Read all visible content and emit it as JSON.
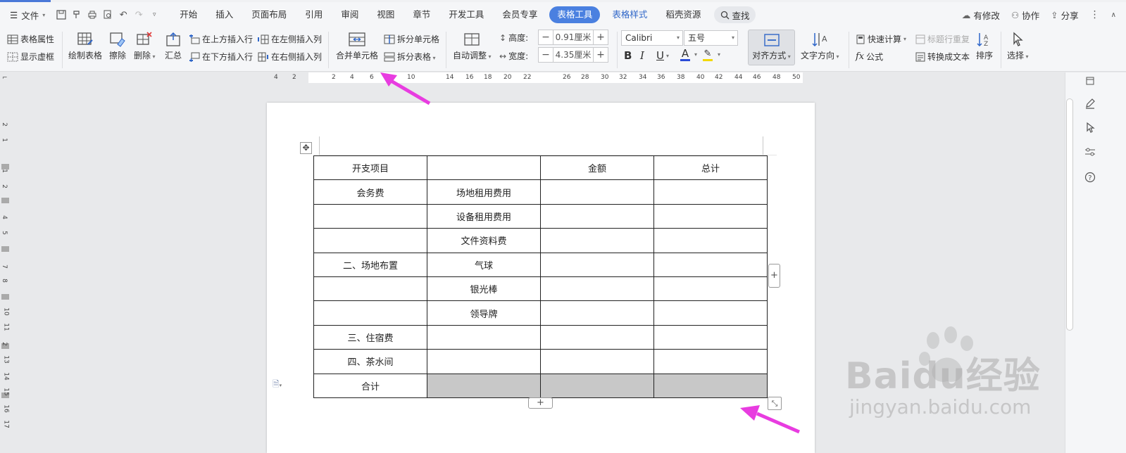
{
  "menubar": {
    "file_label": "文件",
    "tabs": [
      "开始",
      "插入",
      "页面布局",
      "引用",
      "审阅",
      "视图",
      "章节",
      "开发工具",
      "会员专享"
    ],
    "active_tab": "表格工具",
    "blue_tabs": [
      "表格样式",
      "稻壳资源"
    ],
    "search_label": "查找",
    "right": {
      "modify": "有修改",
      "collab": "协作",
      "share": "分享"
    }
  },
  "ribbon": {
    "table_props": "表格属性",
    "show_gridlines": "显示虚框",
    "draw_table": "绘制表格",
    "erase": "擦除",
    "delete": "删除",
    "summary": "汇总",
    "insert_above": "在上方插入行",
    "insert_below": "在下方插入行",
    "insert_left": "在左侧插入列",
    "insert_right": "在右侧插入列",
    "merge_cells": "合并单元格",
    "split_cells": "拆分单元格",
    "split_table": "拆分表格",
    "auto_fit": "自动调整",
    "height_label": "高度:",
    "height_value": "0.91厘米",
    "width_label": "宽度:",
    "width_value": "4.35厘米",
    "font_name": "Calibri",
    "font_size": "五号",
    "align": "对齐方式",
    "text_dir": "文字方向",
    "quick_calc": "快速计算",
    "title_repeat": "标题行重复",
    "formula": "公式",
    "to_text": "转换成文本",
    "sort": "排序",
    "select": "选择"
  },
  "ruler": {
    "numbers": [
      "4",
      "2",
      "2",
      "4",
      "6",
      "10",
      "14",
      "16",
      "18",
      "20",
      "22",
      "26",
      "28",
      "30",
      "32",
      "34",
      "36",
      "38",
      "40",
      "42",
      "44",
      "46",
      "48",
      "50"
    ]
  },
  "vruler": {
    "numbers": [
      "2",
      "1",
      "1",
      "2",
      "4",
      "5",
      "7",
      "8",
      "10",
      "11",
      "2",
      "13",
      "14",
      "15",
      "16",
      "17"
    ]
  },
  "table": {
    "rows": [
      [
        "开支项目",
        "",
        "金额",
        "总计"
      ],
      [
        "会务费",
        "场地租用费用",
        "",
        ""
      ],
      [
        "",
        "设备租用费用",
        "",
        ""
      ],
      [
        "",
        "文件资料费",
        "",
        ""
      ],
      [
        "二、场地布置",
        "气球",
        "",
        ""
      ],
      [
        "",
        "银光棒",
        "",
        ""
      ],
      [
        "",
        "领导牌",
        "",
        ""
      ],
      [
        "三、住宿费",
        "",
        "",
        ""
      ],
      [
        "四、茶水间",
        "",
        "",
        ""
      ],
      [
        "合计",
        "",
        "",
        ""
      ]
    ]
  },
  "watermark": {
    "brand": "Baidu经验",
    "url": "jingyan.baidu.com"
  },
  "colors": {
    "accent": "#4a80e0",
    "annotation_arrow": "#e83ce0",
    "shaded_cell": "#c8c8c8"
  }
}
